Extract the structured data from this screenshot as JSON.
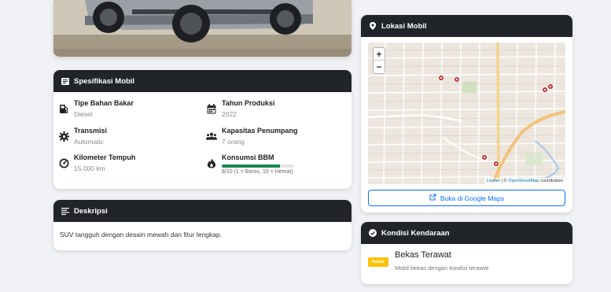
{
  "specs_card": {
    "title": "Spesifikasi Mobil",
    "items": [
      {
        "label": "Tipe Bahan Bakar",
        "value": "Diesel"
      },
      {
        "label": "Tahun Produksi",
        "value": "2022"
      },
      {
        "label": "Transmisi",
        "value": "Automatic"
      },
      {
        "label": "Kapasitas Penumpang",
        "value": "7 orang"
      },
      {
        "label": "Kilometer Tempuh",
        "value": "15.000 km"
      },
      {
        "label": "Konsumsi BBM",
        "caption": "8/10 (1 = Boros, 10 = Hemat)",
        "fuel_score": 8,
        "fuel_max": 10
      }
    ]
  },
  "description_card": {
    "title": "Deskripsi",
    "text": "SUV tangguh dengan desain mewah dan fitur lengkap."
  },
  "location_card": {
    "title": "Lokasi Mobil",
    "map": {
      "zoom_in": "+",
      "zoom_out": "−",
      "attribution_leaflet": "Leaflet",
      "attribution_sep": "| ©",
      "attribution_osm": "OpenStreetMap",
      "attribution_tail": "contributors"
    },
    "button_label": "Buka di Google Maps"
  },
  "condition_card": {
    "title": "Kondisi Kendaraan",
    "badge": "Bekas",
    "status": "Bekas Terawat",
    "subtitle": "Mobil bekas dengan kondisi terawat"
  },
  "colors": {
    "header_bg": "#212529",
    "primary": "#0d6efd",
    "success": "#198754",
    "warning": "#ffc107",
    "marker": "#c0282d",
    "map_road_major": "#f2c27a"
  },
  "icons": [
    "fuel-icon",
    "calendar-icon",
    "gear-icon",
    "users-icon",
    "speedometer-icon",
    "fire-icon",
    "list-icon",
    "map-pin-icon",
    "external-link-icon",
    "check-circle-icon"
  ]
}
